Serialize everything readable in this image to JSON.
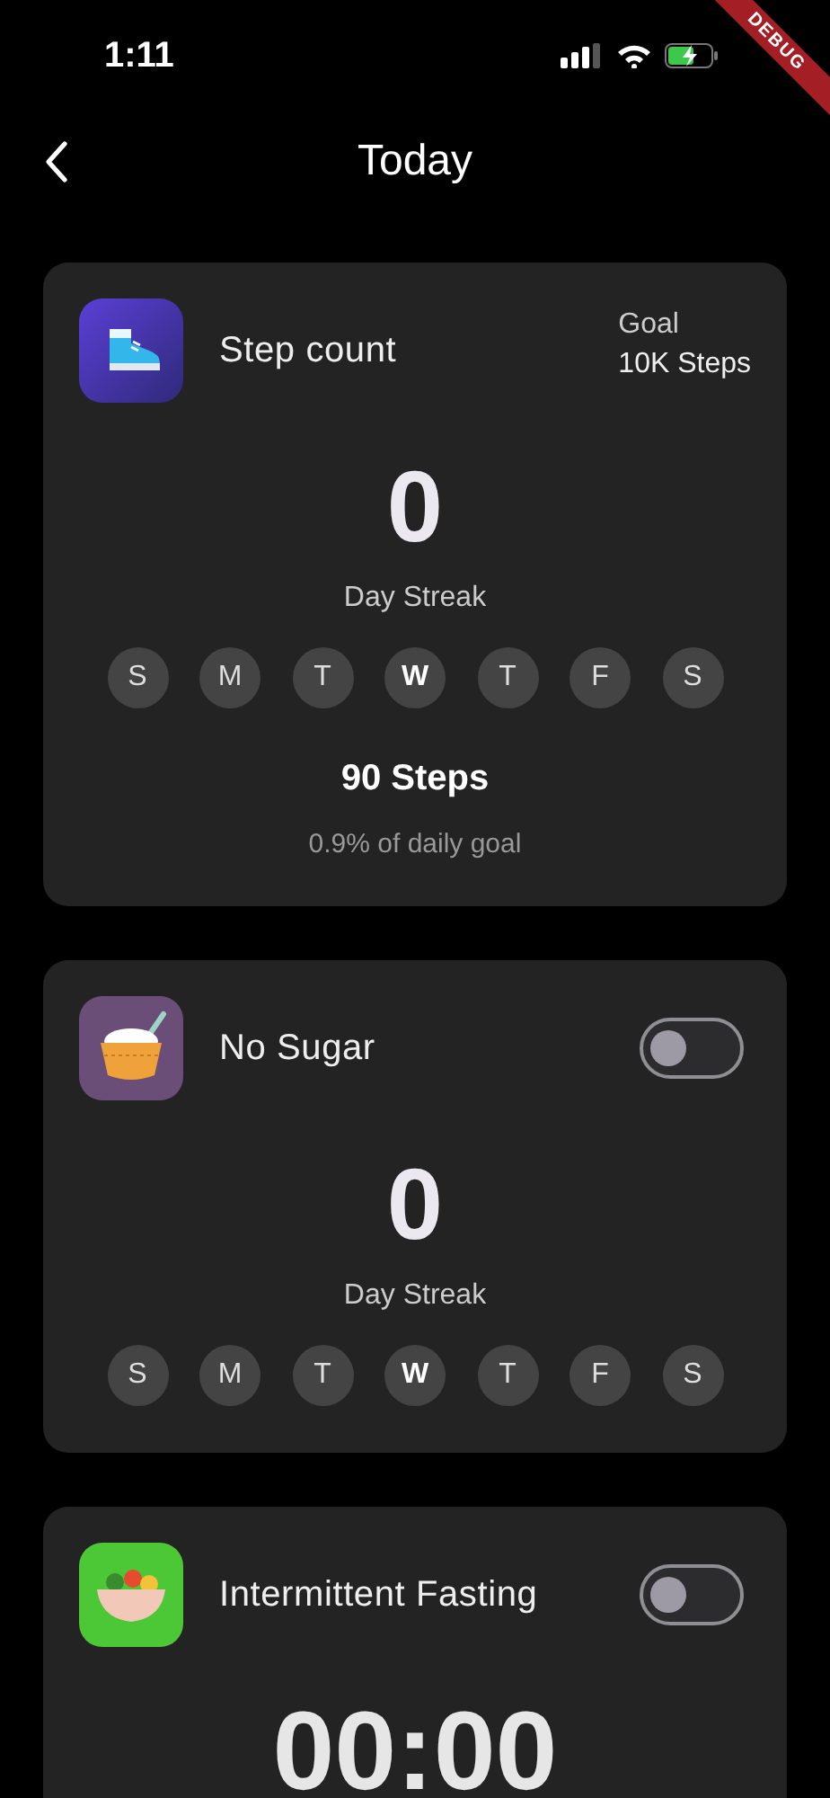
{
  "status_bar": {
    "time": "1:11"
  },
  "debug_banner": "DEBUG",
  "nav": {
    "title": "Today"
  },
  "cards": [
    {
      "kind": "steps",
      "title": "Step count",
      "goal_label": "Goal",
      "goal_value": "10K Steps",
      "streak": "0",
      "streak_label": "Day Streak",
      "days": [
        {
          "label": "S",
          "today": false
        },
        {
          "label": "M",
          "today": false
        },
        {
          "label": "T",
          "today": false
        },
        {
          "label": "W",
          "today": true
        },
        {
          "label": "T",
          "today": false
        },
        {
          "label": "F",
          "today": false
        },
        {
          "label": "S",
          "today": false
        }
      ],
      "steps": "90 Steps",
      "progress": "0.9% of daily goal"
    },
    {
      "kind": "habit",
      "title": "No Sugar",
      "on": false,
      "streak": "0",
      "streak_label": "Day Streak",
      "days": [
        {
          "label": "S",
          "today": false
        },
        {
          "label": "M",
          "today": false
        },
        {
          "label": "T",
          "today": false
        },
        {
          "label": "W",
          "today": true
        },
        {
          "label": "T",
          "today": false
        },
        {
          "label": "F",
          "today": false
        },
        {
          "label": "S",
          "today": false
        }
      ]
    },
    {
      "kind": "fasting",
      "title": "Intermittent Fasting",
      "on": false,
      "timer": "00:00"
    }
  ]
}
